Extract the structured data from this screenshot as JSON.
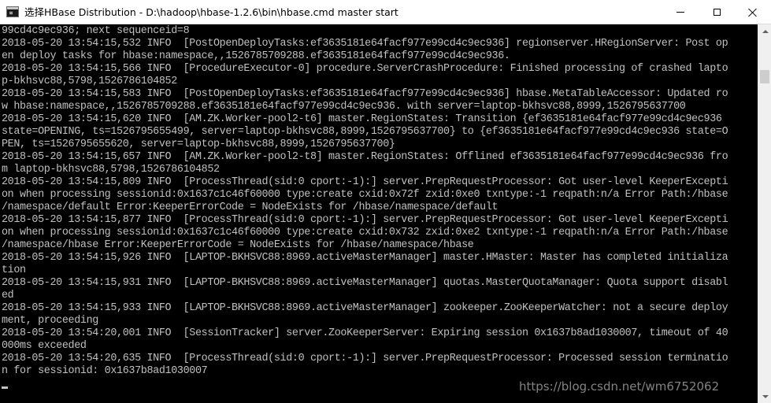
{
  "window": {
    "title": "选择HBase Distribution - D:\\hadoop\\hbase-1.2.6\\bin\\hbase.cmd   master start",
    "icon": "console-icon"
  },
  "console": {
    "text_color": "#c0c0c0",
    "background": "#000000",
    "lines": [
      "99cd4c9ec936; next sequenceid=8",
      "2018-05-20 13:54:15,532 INFO  [PostOpenDeployTasks:ef3635181e64facf977e99cd4c9ec936] regionserver.HRegionServer: Post op",
      "en deploy tasks for hbase:namespace,,1526785709288.ef3635181e64facf977e99cd4c9ec936.",
      "2018-05-20 13:54:15,566 INFO  [ProcedureExecutor-0] procedure.ServerCrashProcedure: Finished processing of crashed lapto",
      "p-bkhsvc88,5798,1526786104852",
      "2018-05-20 13:54:15,583 INFO  [PostOpenDeployTasks:ef3635181e64facf977e99cd4c9ec936] hbase.MetaTableAccessor: Updated ro",
      "w hbase:namespace,,1526785709288.ef3635181e64facf977e99cd4c9ec936. with server=laptop-bkhsvc88,8999,1526795637700",
      "2018-05-20 13:54:15,620 INFO  [AM.ZK.Worker-pool2-t6] master.RegionStates: Transition {ef3635181e64facf977e99cd4c9ec936",
      "state=OPENING, ts=1526795655499, server=laptop-bkhsvc88,8999,1526795637700} to {ef3635181e64facf977e99cd4c9ec936 state=O",
      "PEN, ts=1526795655620, server=laptop-bkhsvc88,8999,1526795637700}",
      "2018-05-20 13:54:15,657 INFO  [AM.ZK.Worker-pool2-t8] master.RegionStates: Offlined ef3635181e64facf977e99cd4c9ec936 fro",
      "m laptop-bkhsvc88,5798,1526786104852",
      "2018-05-20 13:54:15,809 INFO  [ProcessThread(sid:0 cport:-1):] server.PrepRequestProcessor: Got user-level KeeperExcepti",
      "on when processing sessionid:0x1637c1c46f60000 type:create cxid:0x72f zxid:0xe0 txntype:-1 reqpath:n/a Error Path:/hbase",
      "/namespace/default Error:KeeperErrorCode = NodeExists for /hbase/namespace/default",
      "2018-05-20 13:54:15,877 INFO  [ProcessThread(sid:0 cport:-1):] server.PrepRequestProcessor: Got user-level KeeperExcepti",
      "on when processing sessionid:0x1637c1c46f60000 type:create cxid:0x732 zxid:0xe2 txntype:-1 reqpath:n/a Error Path:/hbase",
      "/namespace/hbase Error:KeeperErrorCode = NodeExists for /hbase/namespace/hbase",
      "2018-05-20 13:54:15,926 INFO  [LAPTOP-BKHSVC88:8969.activeMasterManager] master.HMaster: Master has completed initializa",
      "tion",
      "2018-05-20 13:54:15,931 INFO  [LAPTOP-BKHSVC88:8969.activeMasterManager] quotas.MasterQuotaManager: Quota support disabl",
      "ed",
      "2018-05-20 13:54:15,933 INFO  [LAPTOP-BKHSVC88:8969.activeMasterManager] zookeeper.ZooKeeperWatcher: not a secure deploy",
      "ment, proceeding",
      "2018-05-20 13:54:20,001 INFO  [SessionTracker] server.ZooKeeperServer: Expiring session 0x1637b8ad1030007, timeout of 40",
      "000ms exceeded",
      "2018-05-20 13:54:20,635 INFO  [ProcessThread(sid:0 cport:-1):] server.PrepRequestProcessor: Processed session terminatio",
      "n for sessionid: 0x1637b8ad1030007"
    ]
  },
  "watermark": "https://blog.csdn.net/wm6752062",
  "titlebar_buttons": {
    "minimize": "minimize-icon",
    "maximize": "maximize-icon",
    "close": "close-icon"
  }
}
